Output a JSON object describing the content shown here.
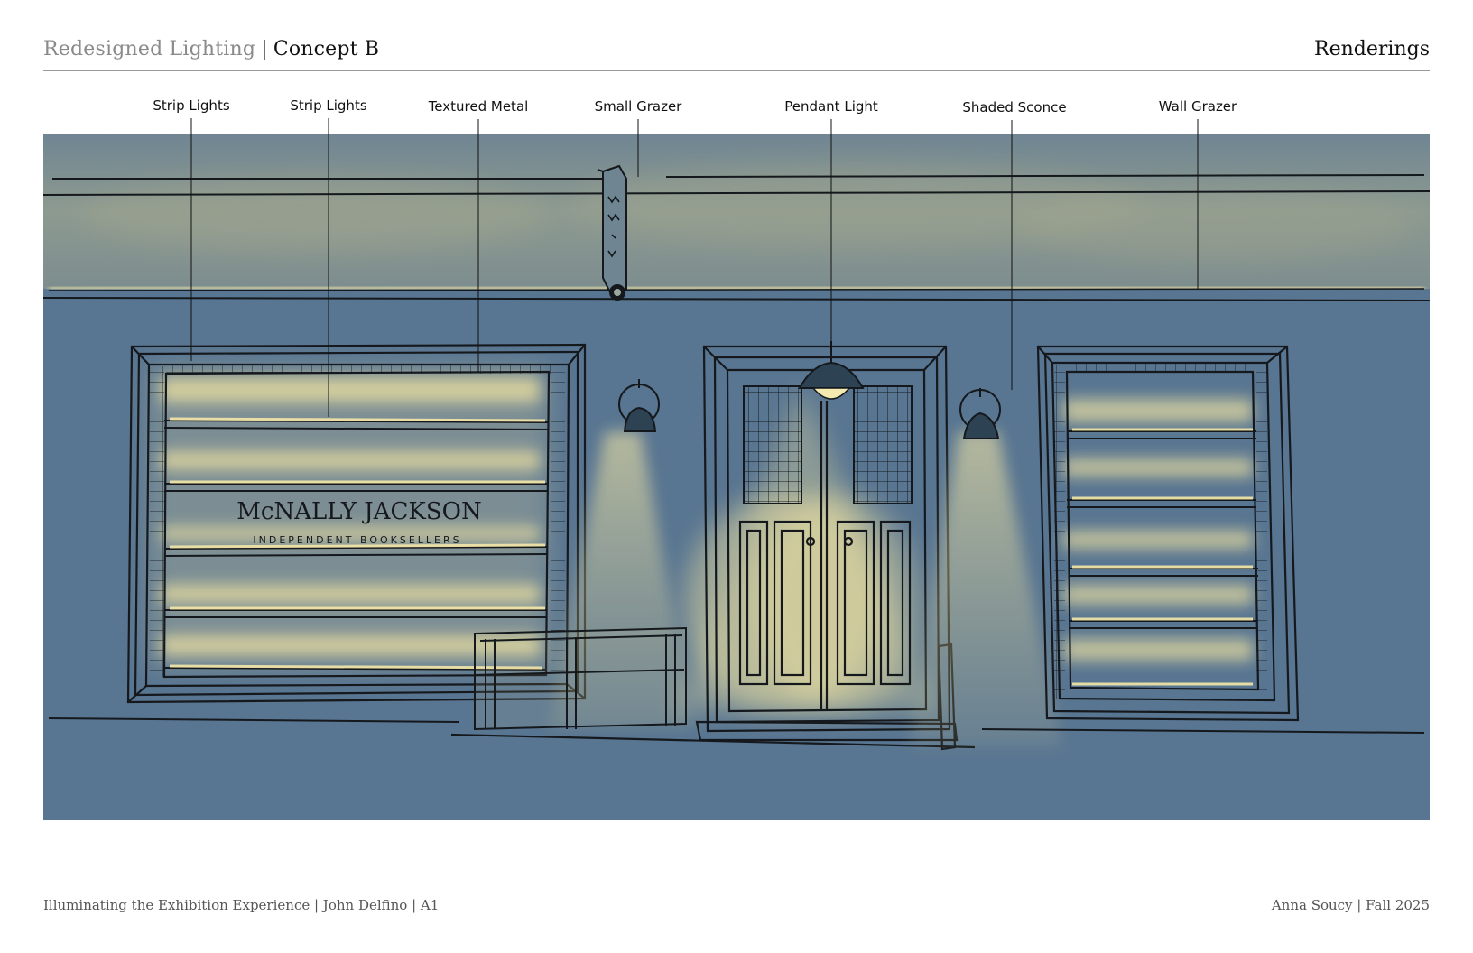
{
  "header": {
    "title_muted": "Redesigned Lighting",
    "separator": "|",
    "title_strong": "Concept B",
    "section": "Renderings"
  },
  "callouts": [
    {
      "label": "Strip Lights"
    },
    {
      "label": "Strip Lights"
    },
    {
      "label": "Textured Metal"
    },
    {
      "label": "Small Grazer"
    },
    {
      "label": "Pendant Light"
    },
    {
      "label": "Shaded Sconce"
    },
    {
      "label": "Wall Grazer"
    }
  ],
  "sign": {
    "name": "McNALLY JACKSON",
    "tagline": "INDEPENDENT BOOKSELLERS"
  },
  "footer": {
    "left": "Illuminating the Exhibition Experience | John Delfino | A1",
    "right": "Anna Soucy | Fall 2025"
  },
  "colors": {
    "wall": "#587591",
    "band": "#7d8f93",
    "glow": "#efe2a0",
    "ink": "#15191d"
  }
}
